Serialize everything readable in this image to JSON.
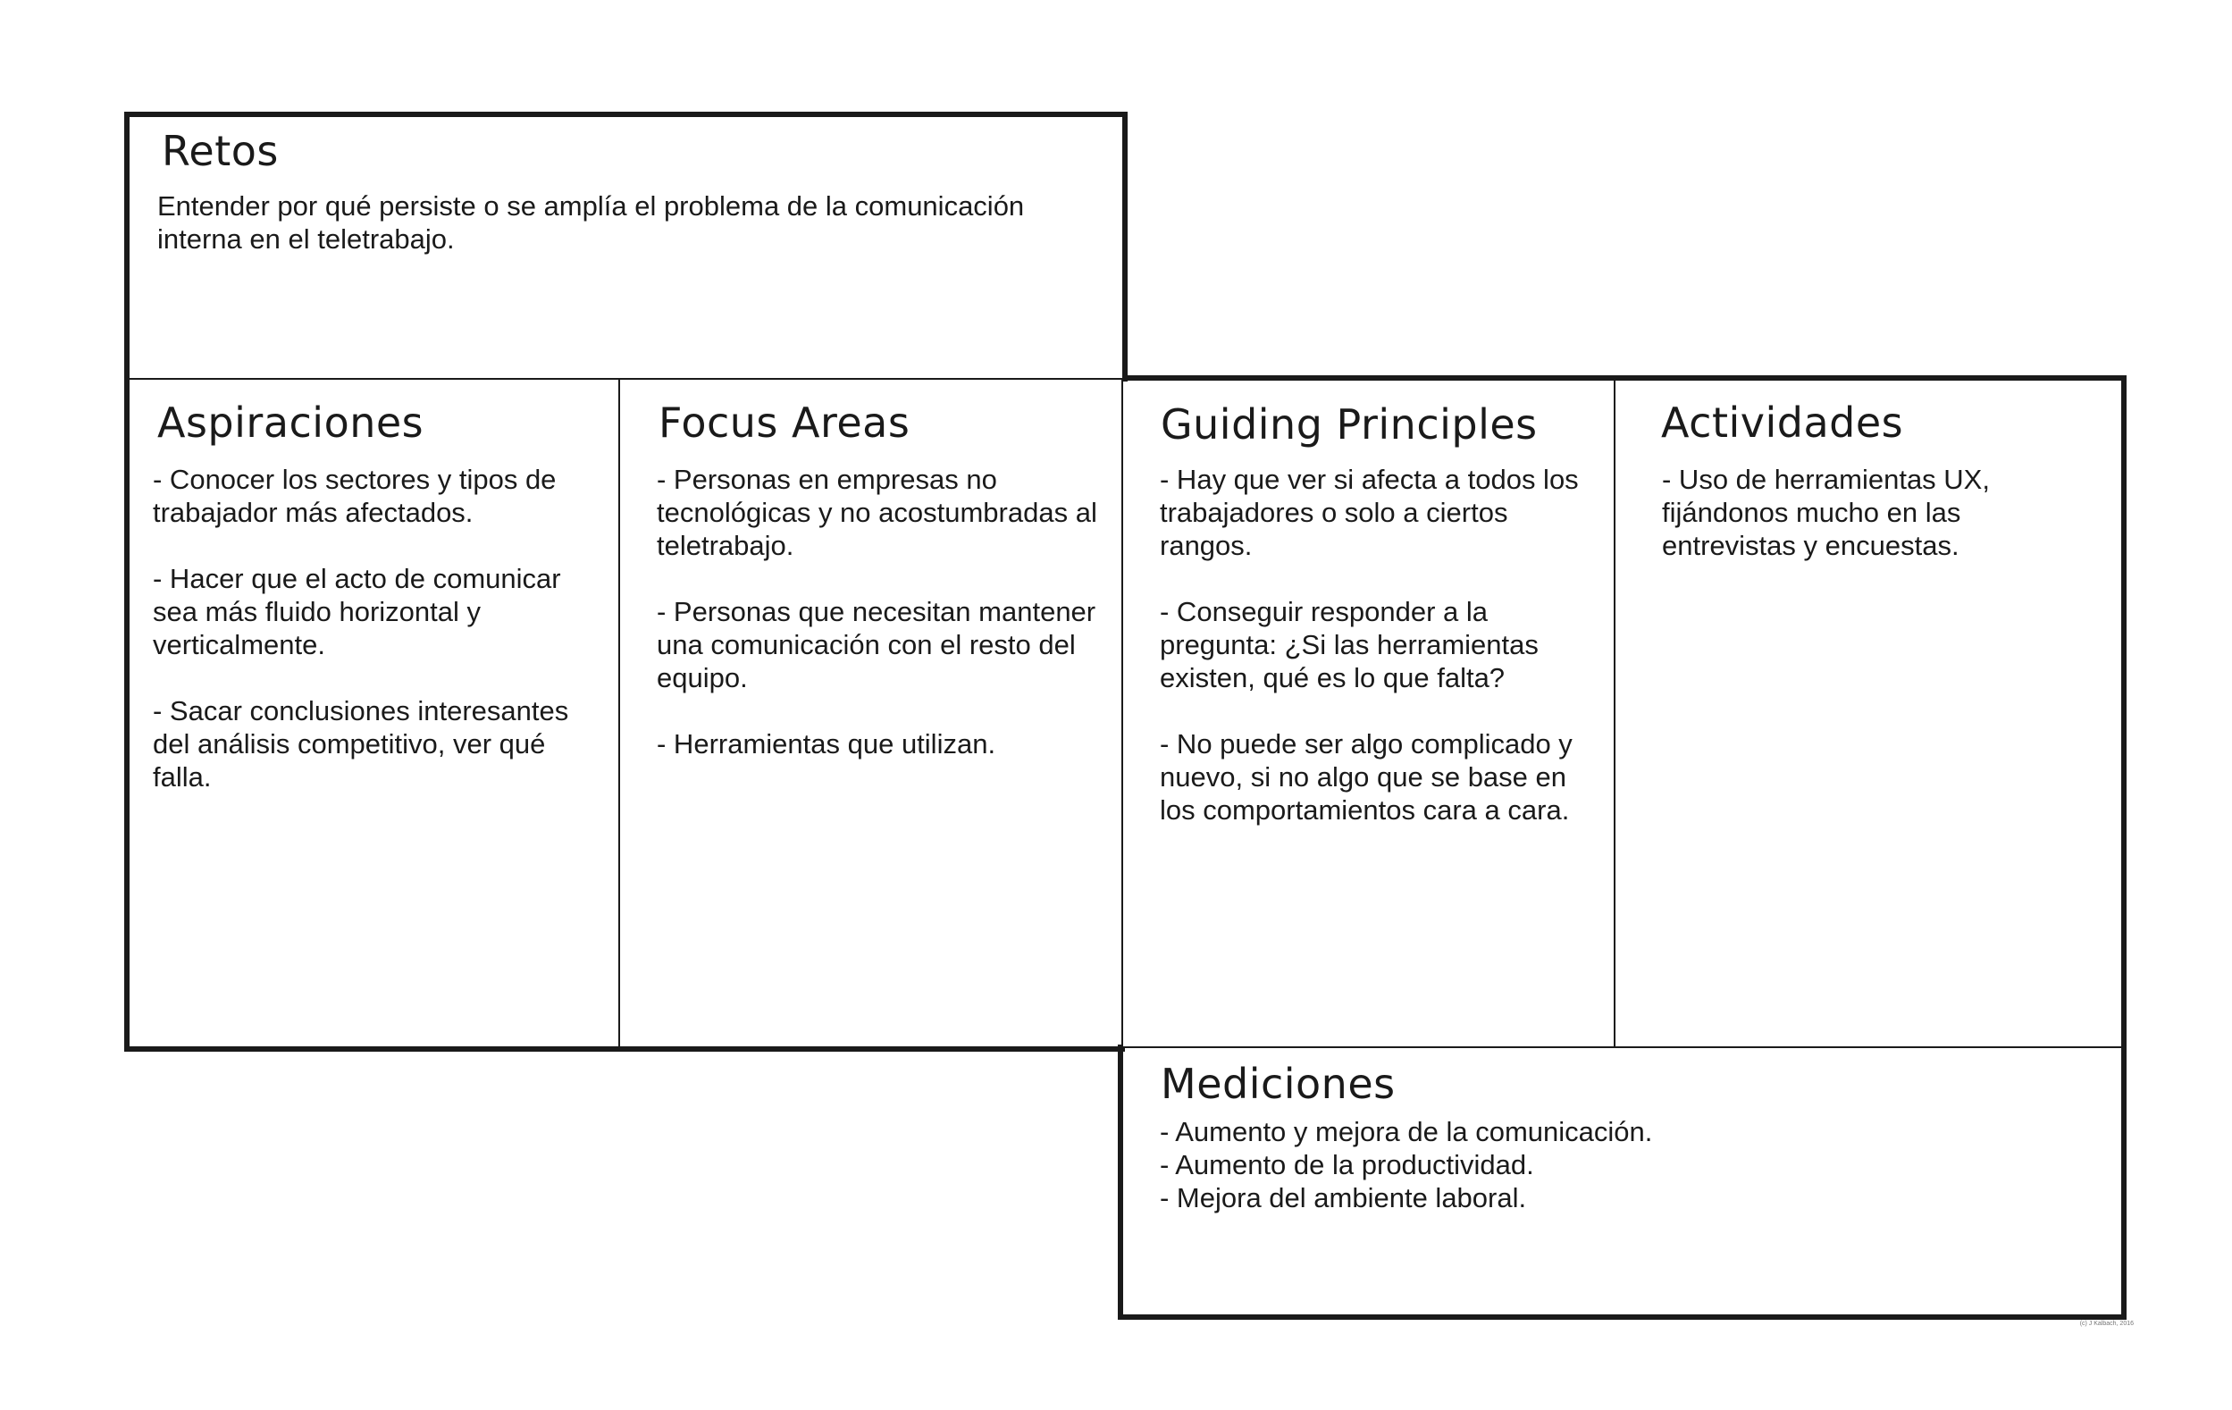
{
  "canvas": {
    "sections": [
      {
        "id": "retos",
        "title": "Retos",
        "paragraphs": [
          "Entender por qué persiste o se amplía el problema de la comunicación interna en el teletrabajo."
        ]
      },
      {
        "id": "aspiraciones",
        "title": "Aspiraciones",
        "paragraphs": [
          "- Conocer los sectores y tipos de trabajador más afectados.",
          "- Hacer que el acto de comunicar sea más fluido horizontal y verticalmente.",
          "- Sacar conclusiones interesantes del análisis competitivo, ver qué falla."
        ]
      },
      {
        "id": "focus-areas",
        "title": "Focus Areas",
        "paragraphs": [
          "- Personas en empresas no tecnológicas y no acostumbradas al teletrabajo.",
          "- Personas que necesitan mantener una comunicación con el resto del equipo.",
          "- Herramientas que utilizan."
        ]
      },
      {
        "id": "guiding-principles",
        "title": "Guiding Principles",
        "paragraphs": [
          "- Hay que ver si afecta a todos los trabajadores o solo a ciertos rangos.",
          "- Conseguir responder a la pregunta: ¿Si las herramientas existen, qué es lo que falta?",
          "- No puede ser algo complicado y nuevo, si no algo que se base en los comportamientos cara a cara."
        ]
      },
      {
        "id": "actividades",
        "title": "Actividades",
        "paragraphs": [
          "- Uso de herramientas UX, fijándonos mucho en las entrevistas y encuestas."
        ]
      },
      {
        "id": "mediciones",
        "title": "Mediciones",
        "paragraphs": [
          "- Aumento y mejora de la comunicación.",
          "- Aumento de la productividad.",
          "- Mejora del ambiente laboral."
        ]
      }
    ],
    "copyright": "(c) J Kalbach, 2016",
    "colors": {
      "line": "#1a1a1a",
      "text": "#1a1a1a",
      "background": "#ffffff"
    }
  }
}
